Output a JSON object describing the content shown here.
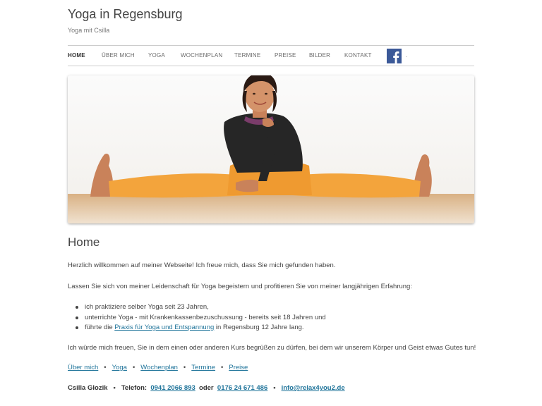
{
  "header": {
    "title": "Yoga in Regensburg",
    "tagline": "Yoga mit Csilla"
  },
  "nav": {
    "items": [
      {
        "label": "Home",
        "active": true
      },
      {
        "label": "Über mich"
      },
      {
        "label": "Yoga"
      },
      {
        "label": "Wochenplan"
      },
      {
        "label": "Termine"
      },
      {
        "label": "Preise"
      },
      {
        "label": "Bilder"
      },
      {
        "label": "Kontakt"
      }
    ],
    "facebook_icon": "facebook-icon",
    "facebook_suffix": "."
  },
  "content": {
    "heading": "Home",
    "intro": "Herzlich willkommen auf meiner Webseite! Ich freue mich, dass Sie mich gefunden haben.",
    "lead": "Lassen Sie sich von meiner Leidenschaft für Yoga begeistern und profitieren Sie von meiner langjährigen Erfahrung:",
    "bullets": [
      {
        "text": "ich praktiziere selber Yoga seit 23 Jahren,"
      },
      {
        "text": "unterrichte Yoga - mit Krankenkassenbezuschussung - bereits seit 18 Jahren und"
      },
      {
        "pre": "führte die ",
        "link": "Praxis für Yoga und Entspannung",
        "post": " in Regensburg 12 Jahre lang."
      }
    ],
    "closing": "Ich würde mich freuen, Sie in dem einen oder anderen Kurs begrüßen zu dürfen, bei dem wir unserem Körper und Geist etwas Gutes tun!",
    "quick_links": [
      "Über mich",
      "Yoga",
      "Wochenplan",
      "Termine",
      "Preise"
    ],
    "separator": "•",
    "contact": {
      "name": "Csilla Glozik",
      "phone_label": "Telefon:",
      "phone1": "0941 2066 893",
      "or": "oder",
      "phone2": "0176 24 671 486",
      "email": "info@relax4you2.de"
    }
  },
  "colors": {
    "link": "#21759b",
    "facebook": "#3b5998",
    "pants": "#f3a43c",
    "floor": "#c99a66"
  }
}
